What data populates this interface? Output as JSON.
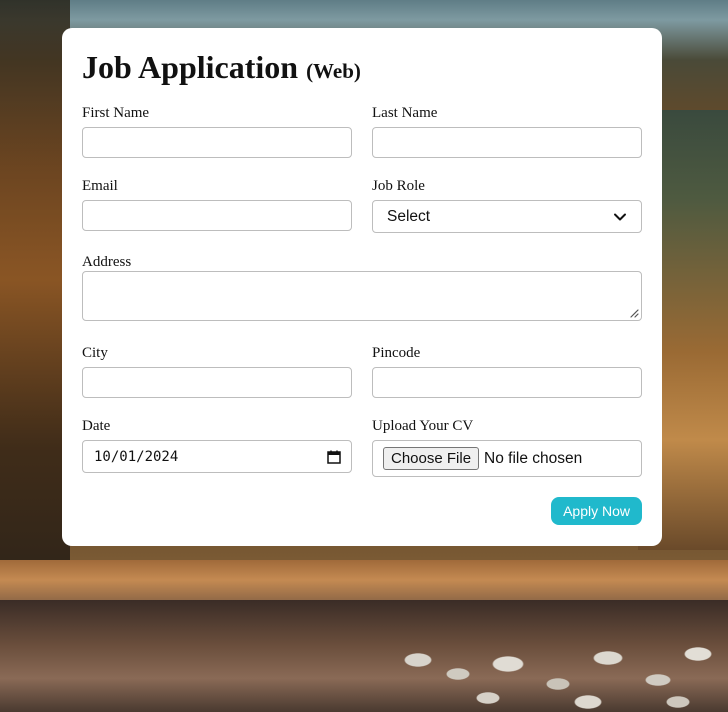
{
  "form": {
    "title": "Job Application",
    "subtitle": "(Web)",
    "first_name": {
      "label": "First Name",
      "value": ""
    },
    "last_name": {
      "label": "Last Name",
      "value": ""
    },
    "email": {
      "label": "Email",
      "value": ""
    },
    "job_role": {
      "label": "Job Role",
      "selected": "Select"
    },
    "address": {
      "label": "Address",
      "value": ""
    },
    "city": {
      "label": "City",
      "value": ""
    },
    "pincode": {
      "label": "Pincode",
      "value": ""
    },
    "date": {
      "label": "Date",
      "value": "10/01/2024"
    },
    "cv": {
      "label": "Upload Your CV",
      "button": "Choose File",
      "status": "No file chosen"
    },
    "submit_label": "Apply Now"
  },
  "colors": {
    "accent": "#20b9cc",
    "card": "#ffffff",
    "border": "#bdbdbd"
  },
  "icons": {
    "select_arrow": "chevron-down-icon",
    "date_picker": "calendar-icon",
    "textarea_resize": "resize-grip-icon"
  }
}
